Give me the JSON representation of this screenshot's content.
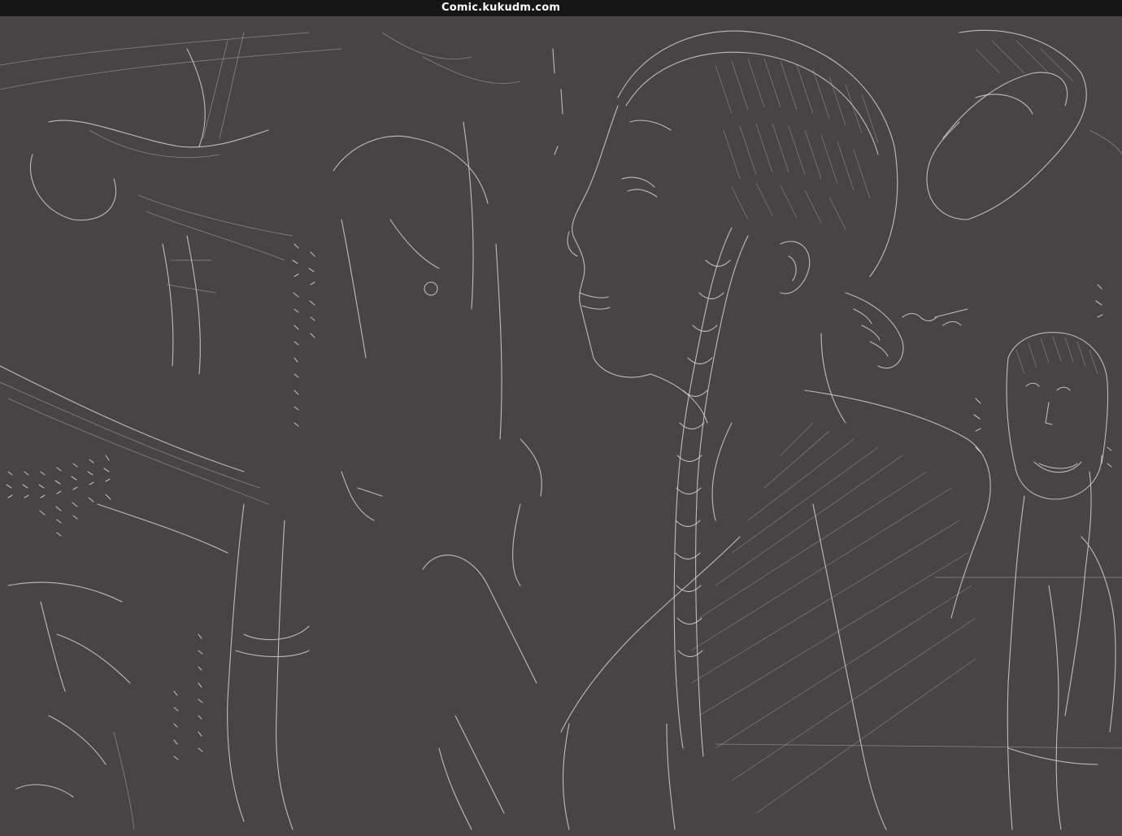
{
  "header": {
    "site_title": "Comic.kukudm.com"
  },
  "content": {
    "image_kind": "pencil-sketch-illustration"
  },
  "colors": {
    "background": "#484445",
    "topbar": "#161616",
    "stroke": "#d4d0cd",
    "title_text": "#ffffff"
  }
}
